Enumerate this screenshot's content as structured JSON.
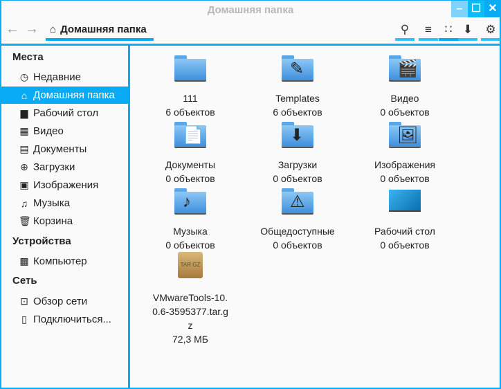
{
  "window": {
    "title": "Домашняя папка"
  },
  "toolbar": {
    "breadcrumb": "Домашняя папка"
  },
  "sidebar": {
    "sections": [
      {
        "title": "Места",
        "items": [
          {
            "label": "Недавние",
            "icon": "clock-icon"
          },
          {
            "label": "Домашняя папка",
            "icon": "home-icon",
            "selected": true
          },
          {
            "label": "Рабочий стол",
            "icon": "desktop-icon"
          },
          {
            "label": "Видео",
            "icon": "film-icon"
          },
          {
            "label": "Документы",
            "icon": "document-icon"
          },
          {
            "label": "Загрузки",
            "icon": "download-icon"
          },
          {
            "label": "Изображения",
            "icon": "image-icon"
          },
          {
            "label": "Музыка",
            "icon": "music-icon"
          },
          {
            "label": "Корзина",
            "icon": "trash-icon"
          }
        ]
      },
      {
        "title": "Устройства",
        "items": [
          {
            "label": "Компьютер",
            "icon": "drive-icon"
          }
        ]
      },
      {
        "title": "Сеть",
        "items": [
          {
            "label": "Обзор сети",
            "icon": "network-icon"
          },
          {
            "label": "Подключиться...",
            "icon": "server-icon"
          }
        ]
      }
    ]
  },
  "files": [
    {
      "name": "111",
      "info": "6 объектов",
      "icon": "folder-icon"
    },
    {
      "name": "Templates",
      "info": "6 объектов",
      "icon": "folder-templates-icon"
    },
    {
      "name": "Видео",
      "info": "0 объектов",
      "icon": "folder-video-icon"
    },
    {
      "name": "Документы",
      "info": "0 объектов",
      "icon": "folder-documents-icon"
    },
    {
      "name": "Загрузки",
      "info": "0 объектов",
      "icon": "folder-download-icon"
    },
    {
      "name": "Изображения",
      "info": "0 объектов",
      "icon": "folder-pictures-icon"
    },
    {
      "name": "Музыка",
      "info": "0 объектов",
      "icon": "folder-music-icon"
    },
    {
      "name": "Общедоступные",
      "info": "0 объектов",
      "icon": "folder-public-icon"
    },
    {
      "name": "Рабочий стол",
      "info": "0 объектов",
      "icon": "desktop-folder-icon"
    },
    {
      "name": "VMwareTools-10.0.6-3595377.tar.gz",
      "info": "72,3 МБ",
      "icon": "archive-icon"
    }
  ],
  "colors": {
    "accent": "#0aabf5"
  }
}
